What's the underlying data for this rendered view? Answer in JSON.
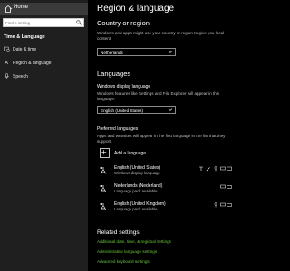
{
  "sidebar": {
    "home_label": "Home",
    "search_placeholder": "Find a setting",
    "section_title": "Time & Language",
    "items": [
      {
        "label": "Date & time"
      },
      {
        "label": "Region & language"
      },
      {
        "label": "Speech"
      }
    ]
  },
  "page": {
    "title": "Region & language",
    "country": {
      "heading": "Country or region",
      "description": "Windows and apps might use your country or region to give you local content",
      "value": "Netherlands"
    },
    "languages": {
      "heading": "Languages",
      "display_label": "Windows display language",
      "display_description": "Windows features like Settings and File Explorer will appear in this language.",
      "display_value": "English (United States)",
      "preferred_label": "Preferred languages",
      "preferred_description": "Apps and websites will appear in the first language in the list that they support.",
      "add_label": "Add a language",
      "list": [
        {
          "name": "English (United States)",
          "sub": "Windows display language"
        },
        {
          "name": "Nederlands (Nederland)",
          "sub": "Language pack available"
        },
        {
          "name": "English (United Kingdom)",
          "sub": "Language pack available"
        }
      ]
    },
    "related": {
      "heading": "Related settings",
      "links": [
        "Additional date, time, & regional settings",
        "Administrative language settings",
        "Advanced keyboard settings"
      ]
    }
  },
  "colors": {
    "sidebar_bg": "#1f1f1f",
    "selected_bg": "#3a3a3a",
    "main_bg": "#000000",
    "link": "#67c23a"
  }
}
